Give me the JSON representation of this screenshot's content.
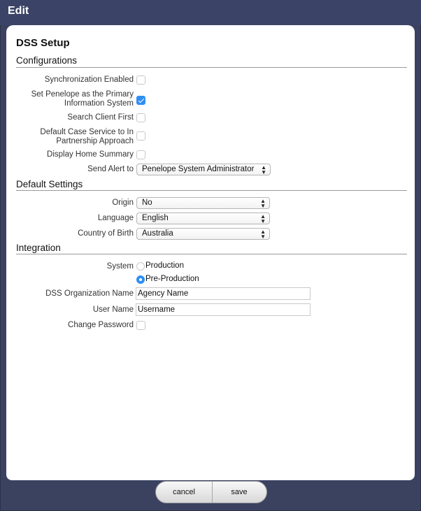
{
  "window": {
    "title": "Edit"
  },
  "page": {
    "title": "DSS Setup"
  },
  "configurations": {
    "section_title": "Configurations",
    "sync_label": "Synchronization Enabled",
    "sync_checked": false,
    "primary_label_1": "Set Penelope as the Primary",
    "primary_label_2": "Information System",
    "primary_checked": true,
    "search_label": "Search Client First",
    "search_checked": false,
    "default_case_label_1": "Default Case Service to In",
    "default_case_label_2": "Partnership Approach",
    "default_case_checked": false,
    "home_summary_label": "Display Home Summary",
    "home_summary_checked": false,
    "send_alert_label": "Send Alert to",
    "send_alert_value": "Penelope System Administrator"
  },
  "default_settings": {
    "section_title": "Default Settings",
    "origin_label": "Origin",
    "origin_value": "No",
    "language_label": "Language",
    "language_value": "English",
    "country_label": "Country of Birth",
    "country_value": "Australia"
  },
  "integration": {
    "section_title": "Integration",
    "system_label": "System",
    "system_options": [
      "Production",
      "Pre-Production"
    ],
    "system_selected": "Pre-Production",
    "org_name_label": "DSS Organization Name",
    "org_name_value": "Agency Name",
    "user_name_label": "User Name",
    "user_name_value": "Username",
    "change_password_label": "Change Password",
    "change_password_checked": false
  },
  "footer": {
    "cancel_label": "cancel",
    "save_label": "save"
  },
  "colors": {
    "titlebar": "#3b4466",
    "accent": "#2f8ff2",
    "background": "#3a4260"
  }
}
